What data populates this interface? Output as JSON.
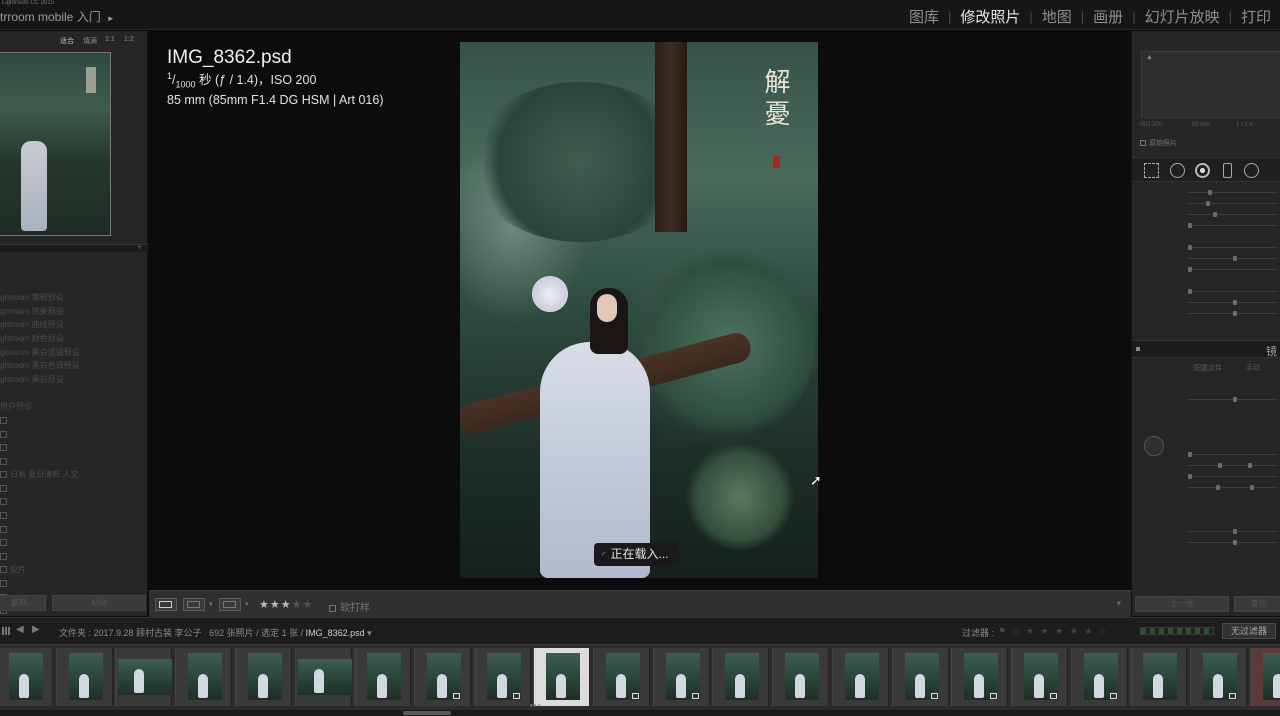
{
  "app": {
    "name": "Lightroom CC 2015",
    "identity": "trroom mobile 入门",
    "identity_arrow": "►"
  },
  "modules": [
    {
      "label": "图库",
      "active": false
    },
    {
      "label": "修改照片",
      "active": true
    },
    {
      "label": "地图",
      "active": false
    },
    {
      "label": "画册",
      "active": false
    },
    {
      "label": "幻灯片放映",
      "active": false
    },
    {
      "label": "打印",
      "active": false
    }
  ],
  "navigator": {
    "fit": "适合",
    "fill": "填满",
    "ratio": "1:1",
    "zoom": "1:2"
  },
  "presets": [
    "",
    "",
    "ghtroom 常规预设",
    "ghtroom 效果预设",
    "ghtroom 曲线预设",
    "ghtroom 颜色预设",
    "ghtroom 黑白滤镜预设",
    "ghtroom 黑白色调预设",
    "ghtroom 黑白预设",
    "",
    "用户预设",
    "",
    "",
    "",
    "",
    "日系 夏日清新 人文",
    "",
    "",
    "",
    "",
    "",
    "",
    "胶片",
    "",
    "",
    "",
    "",
    ""
  ],
  "left_buttons": {
    "copy": "复制...",
    "paste": "粘贴"
  },
  "photo_info": {
    "filename": "IMG_8362.psd",
    "shutter_num": "1",
    "shutter_den": "1000",
    "exposure_rest": " 秒 (ƒ / 1.4)，ISO 200",
    "lens": "85 mm (85mm F1.4 DG HSM | Art 016)"
  },
  "photo_text": {
    "calligraphy": "解憂"
  },
  "loading": {
    "text": "正在载入..."
  },
  "toolbar": {
    "stars_on": "★★★",
    "stars_off": "★★",
    "softproof": "软打样"
  },
  "exif": {
    "iso": "ISO 200",
    "focal": "85 mm",
    "aperture": "ƒ / 1.4"
  },
  "right_panel": {
    "original": "原始照片",
    "section_title": "镜",
    "tab_profile": "配置文件",
    "tab_manual": "手动",
    "prev_button": "上一张",
    "reset_button": "复位"
  },
  "filmstrip_bar": {
    "path_prefix": "文件夹 : 2017.9.28 顾村古装 李公子",
    "count": "692 张照片 / 选定 1 张 /",
    "selected_file": "IMG_8362.psd",
    "filter_label": "过滤器 :",
    "no_filter": "无过滤器"
  },
  "thumbnails": [
    {
      "wide": false,
      "badge": false,
      "state": "normal"
    },
    {
      "wide": false,
      "badge": false,
      "state": "normal"
    },
    {
      "wide": true,
      "badge": false,
      "state": "normal"
    },
    {
      "wide": false,
      "badge": false,
      "state": "normal"
    },
    {
      "wide": false,
      "badge": false,
      "state": "normal"
    },
    {
      "wide": true,
      "badge": false,
      "state": "normal"
    },
    {
      "wide": false,
      "badge": false,
      "state": "normal"
    },
    {
      "wide": false,
      "badge": true,
      "state": "normal"
    },
    {
      "wide": false,
      "badge": true,
      "state": "normal"
    },
    {
      "wide": false,
      "badge": false,
      "state": "selected"
    },
    {
      "wide": false,
      "badge": true,
      "state": "normal"
    },
    {
      "wide": false,
      "badge": true,
      "state": "normal"
    },
    {
      "wide": false,
      "badge": false,
      "state": "normal"
    },
    {
      "wide": false,
      "badge": false,
      "state": "normal"
    },
    {
      "wide": false,
      "badge": false,
      "state": "normal"
    },
    {
      "wide": false,
      "badge": true,
      "state": "normal"
    },
    {
      "wide": false,
      "badge": true,
      "state": "normal"
    },
    {
      "wide": false,
      "badge": true,
      "state": "normal"
    },
    {
      "wide": false,
      "badge": true,
      "state": "normal"
    },
    {
      "wide": false,
      "badge": false,
      "state": "normal"
    },
    {
      "wide": false,
      "badge": true,
      "state": "normal"
    },
    {
      "wide": false,
      "badge": false,
      "state": "flagged"
    }
  ],
  "colors": {
    "accent_selected": "#dcdcdc",
    "background": "#0d0d0d",
    "panel": "#262626"
  }
}
